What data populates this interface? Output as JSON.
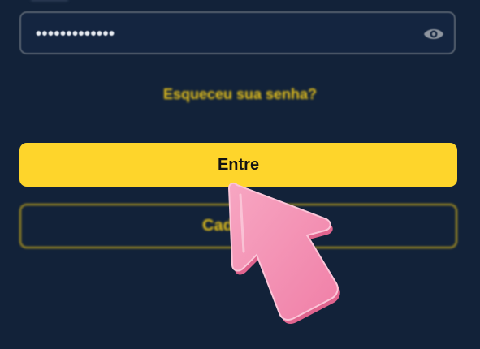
{
  "login_form": {
    "password_field": {
      "value": "•••••••••••••",
      "visibility_icon": "eye-icon"
    },
    "forgot_password_link": "Esqueceu sua senha?",
    "submit_button": "Entre",
    "register_button_visible": "Cad"
  },
  "overlay": {
    "pointer_icon": "pointer-arrow-icon"
  },
  "colors": {
    "background": "#122239",
    "accent": "#fed52b",
    "link": "#e7c21c",
    "field_border": "#56616f",
    "pointer": "#f48fb1"
  }
}
